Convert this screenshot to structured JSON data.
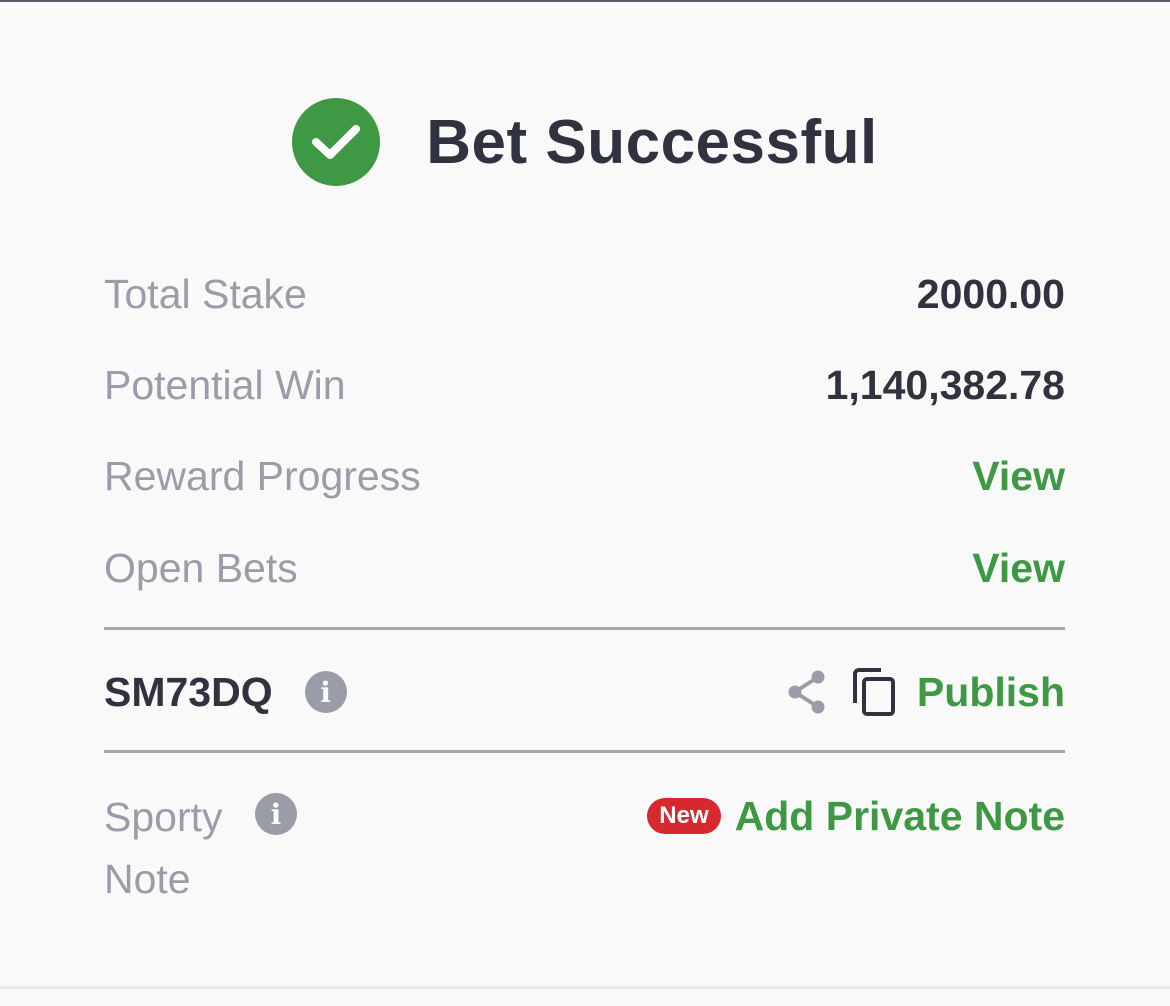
{
  "header": {
    "title": "Bet Successful",
    "icon": "check-circle-icon",
    "icon_color": "#3f9944"
  },
  "summary": [
    {
      "label": "Total Stake",
      "value": "2000.00"
    },
    {
      "label": "Potential Win",
      "value": "1,140,382.78"
    }
  ],
  "links": [
    {
      "label": "Reward Progress",
      "action": "View"
    },
    {
      "label": "Open Bets",
      "action": "View"
    }
  ],
  "booking": {
    "code": "SM73DQ",
    "info_icon": "info-icon",
    "share_icon": "share-icon",
    "copy_icon": "copy-icon",
    "publish_label": "Publish"
  },
  "note": {
    "label": "Sporty Note",
    "label_line1": "Sporty",
    "label_line2": "Note",
    "badge": "New",
    "action": "Add Private Note"
  },
  "colors": {
    "accent_green": "#3f9944",
    "badge_red": "#d7282f",
    "label_gray": "#9a9ca8",
    "text_dark": "#30333f"
  }
}
